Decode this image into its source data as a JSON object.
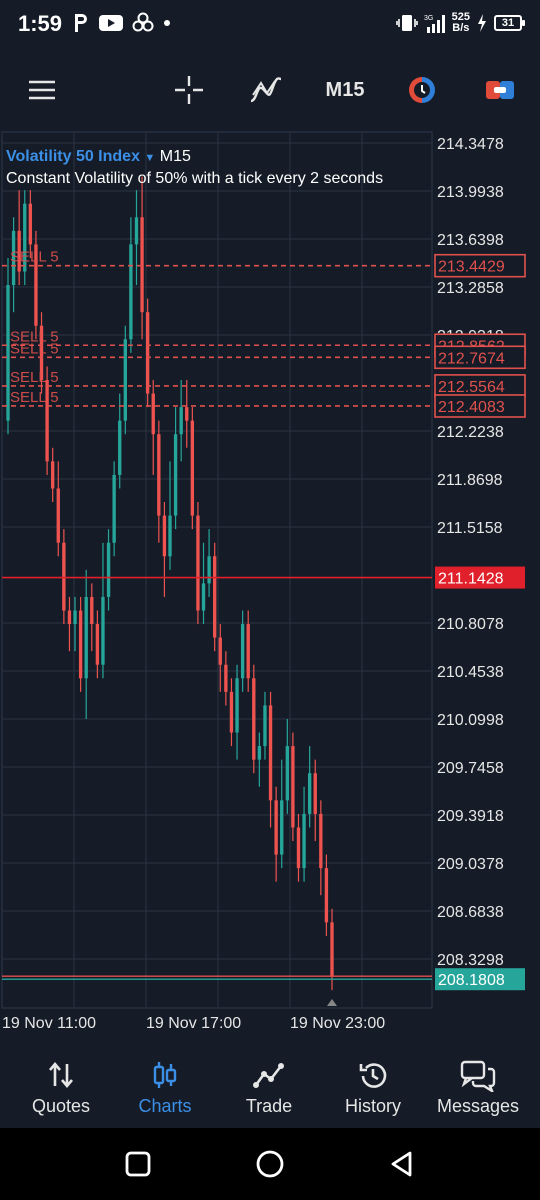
{
  "status_bar": {
    "time": "1:59",
    "net_speed_value": "525",
    "net_speed_unit": "B/s",
    "battery": "31"
  },
  "toolbar": {
    "timeframe": "M15",
    "icons": [
      "menu-icon",
      "crosshair-icon",
      "indicators-icon",
      "timeframe",
      "one-click-trading-icon",
      "trade-panel-icon"
    ]
  },
  "chart": {
    "symbol": "Volatility 50 Index",
    "timeframe": "M15",
    "description": "Constant Volatility of 50% with a tick every 2 seconds",
    "colors": {
      "bull": "#26a69a",
      "bear": "#ef5350",
      "background": "#151c27",
      "grid": "#2a3344"
    }
  },
  "chart_data": {
    "type": "candlestick",
    "y_ticks": [
      "214.3478",
      "213.9938",
      "213.6398",
      "213.2858",
      "212.9318",
      "212.2238",
      "211.8698",
      "211.5158",
      "210.8078",
      "210.4538",
      "210.0998",
      "209.7458",
      "209.3918",
      "209.0378",
      "208.6838",
      "208.3298"
    ],
    "ylim": [
      208.1,
      214.4
    ],
    "x_ticks": [
      "19 Nov 11:00",
      "19 Nov 17:00",
      "19 Nov 23:00"
    ],
    "order_lines": [
      {
        "label": "SELL 5",
        "price": "213.4429"
      },
      {
        "label": "SELL 5",
        "price": "212.8562"
      },
      {
        "label": "SELL 5",
        "price": "212.7674"
      },
      {
        "label": "SELL 5",
        "price": "212.5564"
      },
      {
        "label": "SELL 5",
        "price": "212.4083"
      }
    ],
    "bid_line_price": "211.1428",
    "current_price": "208.1808",
    "candles": [
      [
        212.3,
        213.3,
        212.2,
        213.5
      ],
      [
        213.3,
        213.7,
        213.1,
        213.8
      ],
      [
        213.7,
        213.4,
        213.3,
        214.0
      ],
      [
        213.4,
        213.9,
        213.3,
        214.0
      ],
      [
        213.9,
        213.6,
        213.5,
        214.0
      ],
      [
        213.6,
        213.0,
        212.9,
        213.7
      ],
      [
        213.0,
        212.6,
        212.5,
        213.1
      ],
      [
        212.6,
        212.0,
        211.9,
        212.7
      ],
      [
        212.0,
        211.8,
        211.7,
        212.1
      ],
      [
        211.8,
        211.4,
        211.3,
        212.0
      ],
      [
        211.4,
        210.9,
        210.8,
        211.5
      ],
      [
        210.9,
        210.8,
        210.6,
        211.0
      ],
      [
        210.8,
        210.9,
        210.6,
        211.0
      ],
      [
        210.9,
        210.4,
        210.3,
        211.0
      ],
      [
        210.4,
        211.0,
        210.1,
        211.2
      ],
      [
        211.0,
        210.8,
        210.6,
        211.1
      ],
      [
        210.8,
        210.5,
        210.4,
        210.9
      ],
      [
        210.5,
        211.0,
        210.4,
        211.4
      ],
      [
        211.0,
        211.4,
        210.9,
        211.5
      ],
      [
        211.4,
        211.9,
        211.3,
        212.0
      ],
      [
        211.9,
        212.3,
        211.8,
        212.5
      ],
      [
        212.3,
        212.9,
        212.2,
        213.0
      ],
      [
        212.9,
        213.6,
        212.8,
        213.8
      ],
      [
        213.6,
        213.8,
        213.3,
        214.0
      ],
      [
        213.8,
        213.1,
        212.9,
        214.1
      ],
      [
        213.1,
        212.5,
        212.4,
        213.2
      ],
      [
        212.5,
        212.2,
        211.9,
        212.6
      ],
      [
        212.2,
        211.6,
        211.4,
        212.3
      ],
      [
        211.6,
        211.3,
        211.0,
        211.7
      ],
      [
        211.3,
        211.6,
        211.2,
        212.0
      ],
      [
        211.6,
        212.2,
        211.5,
        212.4
      ],
      [
        212.2,
        212.4,
        212.0,
        212.6
      ],
      [
        212.4,
        212.3,
        212.1,
        212.6
      ],
      [
        212.3,
        211.6,
        211.5,
        212.4
      ],
      [
        211.6,
        210.9,
        210.8,
        211.7
      ],
      [
        210.9,
        211.1,
        210.8,
        211.4
      ],
      [
        211.1,
        211.3,
        211.0,
        211.5
      ],
      [
        211.3,
        210.7,
        210.6,
        211.4
      ],
      [
        210.7,
        210.5,
        210.3,
        210.8
      ],
      [
        210.5,
        210.3,
        210.2,
        210.6
      ],
      [
        210.3,
        210.0,
        209.9,
        210.4
      ],
      [
        210.0,
        210.4,
        209.8,
        210.5
      ],
      [
        210.4,
        210.8,
        210.3,
        210.9
      ],
      [
        210.8,
        210.4,
        210.3,
        210.9
      ],
      [
        210.4,
        209.8,
        209.7,
        210.5
      ],
      [
        209.8,
        209.9,
        209.6,
        210.0
      ],
      [
        209.9,
        210.2,
        209.8,
        210.3
      ],
      [
        210.2,
        209.5,
        209.3,
        210.3
      ],
      [
        209.5,
        209.1,
        208.9,
        209.6
      ],
      [
        209.1,
        209.5,
        209.0,
        209.8
      ],
      [
        209.5,
        209.9,
        209.4,
        210.1
      ],
      [
        209.9,
        209.3,
        209.2,
        210.0
      ],
      [
        209.3,
        209.0,
        208.9,
        209.4
      ],
      [
        209.0,
        209.4,
        208.9,
        209.6
      ],
      [
        209.4,
        209.7,
        209.3,
        209.9
      ],
      [
        209.7,
        209.4,
        209.2,
        209.8
      ],
      [
        209.4,
        209.0,
        208.8,
        209.5
      ],
      [
        209.0,
        208.6,
        208.5,
        209.1
      ],
      [
        208.6,
        208.2,
        208.1,
        208.7
      ]
    ]
  },
  "bottom_nav": [
    {
      "label": "Quotes",
      "icon": "quotes-icon",
      "active": false
    },
    {
      "label": "Charts",
      "icon": "charts-icon",
      "active": true
    },
    {
      "label": "Trade",
      "icon": "trade-icon",
      "active": false
    },
    {
      "label": "History",
      "icon": "history-icon",
      "active": false
    },
    {
      "label": "Messages",
      "icon": "messages-icon",
      "active": false
    }
  ]
}
